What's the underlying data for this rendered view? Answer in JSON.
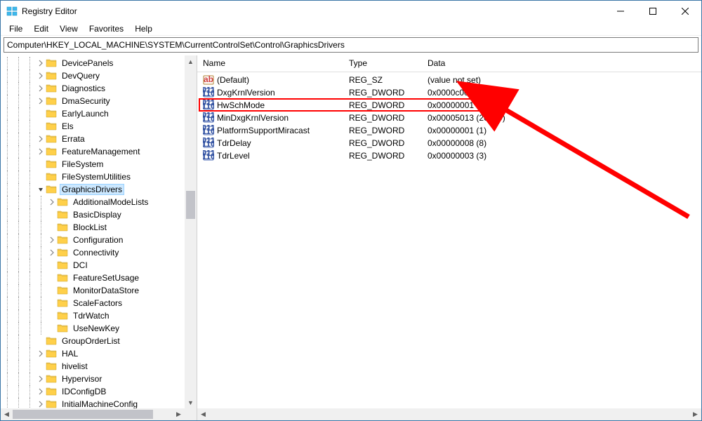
{
  "window": {
    "title": "Registry Editor"
  },
  "menu": {
    "file": "File",
    "edit": "Edit",
    "view": "View",
    "favorites": "Favorites",
    "help": "Help"
  },
  "address": "Computer\\HKEY_LOCAL_MACHINE\\SYSTEM\\CurrentControlSet\\Control\\GraphicsDrivers",
  "tree": {
    "items": [
      {
        "indent": 3,
        "expander": "closed",
        "label": "DevicePanels"
      },
      {
        "indent": 3,
        "expander": "closed",
        "label": "DevQuery"
      },
      {
        "indent": 3,
        "expander": "closed",
        "label": "Diagnostics"
      },
      {
        "indent": 3,
        "expander": "closed",
        "label": "DmaSecurity"
      },
      {
        "indent": 3,
        "expander": "none",
        "label": "EarlyLaunch"
      },
      {
        "indent": 3,
        "expander": "none",
        "label": "Els"
      },
      {
        "indent": 3,
        "expander": "closed",
        "label": "Errata"
      },
      {
        "indent": 3,
        "expander": "closed",
        "label": "FeatureManagement"
      },
      {
        "indent": 3,
        "expander": "none",
        "label": "FileSystem"
      },
      {
        "indent": 3,
        "expander": "none",
        "label": "FileSystemUtilities"
      },
      {
        "indent": 3,
        "expander": "open",
        "label": "GraphicsDrivers",
        "selected": true
      },
      {
        "indent": 4,
        "expander": "closed",
        "label": "AdditionalModeLists"
      },
      {
        "indent": 4,
        "expander": "none",
        "label": "BasicDisplay"
      },
      {
        "indent": 4,
        "expander": "none",
        "label": "BlockList"
      },
      {
        "indent": 4,
        "expander": "closed",
        "label": "Configuration"
      },
      {
        "indent": 4,
        "expander": "closed",
        "label": "Connectivity"
      },
      {
        "indent": 4,
        "expander": "none",
        "label": "DCI"
      },
      {
        "indent": 4,
        "expander": "none",
        "label": "FeatureSetUsage"
      },
      {
        "indent": 4,
        "expander": "none",
        "label": "MonitorDataStore"
      },
      {
        "indent": 4,
        "expander": "none",
        "label": "ScaleFactors"
      },
      {
        "indent": 4,
        "expander": "none",
        "label": "TdrWatch"
      },
      {
        "indent": 4,
        "expander": "none",
        "label": "UseNewKey"
      },
      {
        "indent": 3,
        "expander": "none",
        "label": "GroupOrderList"
      },
      {
        "indent": 3,
        "expander": "closed",
        "label": "HAL"
      },
      {
        "indent": 3,
        "expander": "none",
        "label": "hivelist"
      },
      {
        "indent": 3,
        "expander": "closed",
        "label": "Hypervisor"
      },
      {
        "indent": 3,
        "expander": "closed",
        "label": "IDConfigDB"
      },
      {
        "indent": 3,
        "expander": "closed",
        "label": "InitialMachineConfig"
      }
    ]
  },
  "columns": {
    "name": "Name",
    "type": "Type",
    "data": "Data"
  },
  "values": [
    {
      "icon": "sz",
      "name": "(Default)",
      "type": "REG_SZ",
      "data": "(value not set)"
    },
    {
      "icon": "bin",
      "name": "DxgKrnlVersion",
      "type": "REG_DWORD",
      "data": "0x0000c004 (49156)"
    },
    {
      "icon": "bin",
      "name": "HwSchMode",
      "type": "REG_DWORD",
      "data": "0x00000001 (1)",
      "highlighted": true
    },
    {
      "icon": "bin",
      "name": "MinDxgKrnlVersion",
      "type": "REG_DWORD",
      "data": "0x00005013 (20499)"
    },
    {
      "icon": "bin",
      "name": "PlatformSupportMiracast",
      "type": "REG_DWORD",
      "data": "0x00000001 (1)"
    },
    {
      "icon": "bin",
      "name": "TdrDelay",
      "type": "REG_DWORD",
      "data": "0x00000008 (8)"
    },
    {
      "icon": "bin",
      "name": "TdrLevel",
      "type": "REG_DWORD",
      "data": "0x00000003 (3)"
    }
  ],
  "colors": {
    "highlight": "#ff0000",
    "selection_bg": "#cce8ff",
    "folder": "#ffd04a",
    "string_icon_bg": "#ffffff",
    "binary_icon_bg": "#ffffff"
  }
}
